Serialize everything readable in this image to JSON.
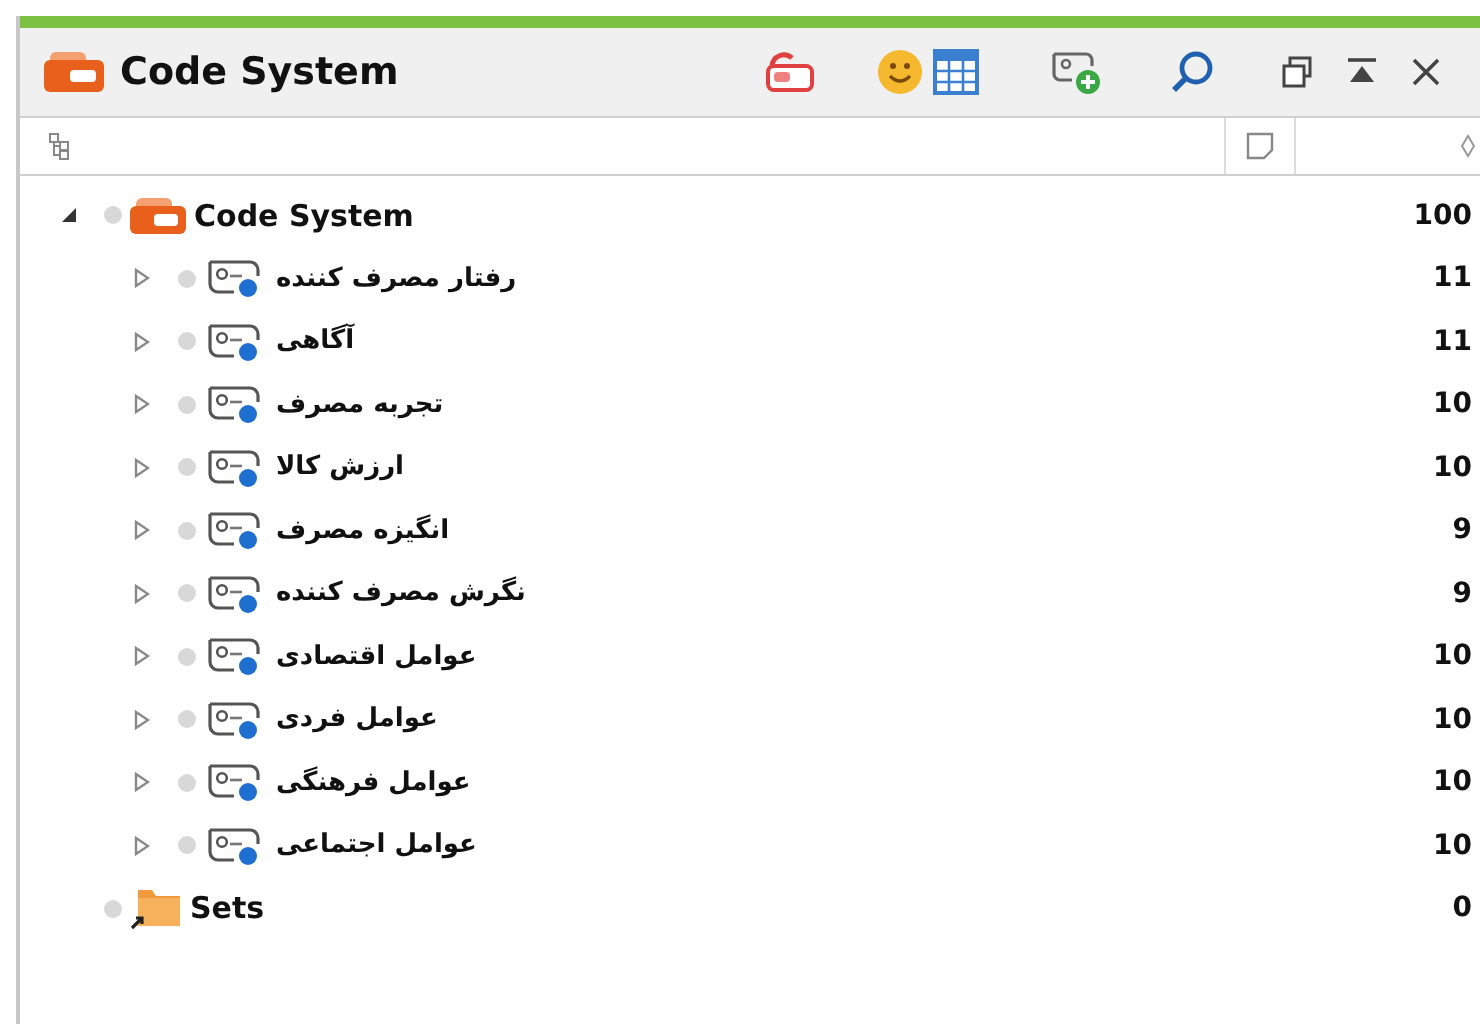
{
  "panel": {
    "title": "Code System"
  },
  "tree": [
    {
      "kind": "system",
      "label": "Code System",
      "count": "100",
      "expanded": true,
      "children": [
        {
          "label": "رفتار مصرف کننده",
          "count": "11",
          "expanded": false
        },
        {
          "label": "آگاهی",
          "count": "11",
          "expanded": false
        },
        {
          "label": "تجربه مصرف",
          "count": "10",
          "expanded": false
        },
        {
          "label": "ارزش کالا",
          "count": "10",
          "expanded": false
        },
        {
          "label": "انگیزه مصرف",
          "count": "9",
          "expanded": false
        },
        {
          "label": "نگرش مصرف کننده",
          "count": "9",
          "expanded": false
        },
        {
          "label": "عوامل اقتصادی",
          "count": "10",
          "expanded": false
        },
        {
          "label": "عوامل فردی",
          "count": "10",
          "expanded": false
        },
        {
          "label": "عوامل فرهنگی",
          "count": "10",
          "expanded": false
        },
        {
          "label": "عوامل اجتماعی",
          "count": "10",
          "expanded": false
        }
      ]
    },
    {
      "kind": "sets",
      "label": "Sets",
      "count": "0"
    }
  ]
}
